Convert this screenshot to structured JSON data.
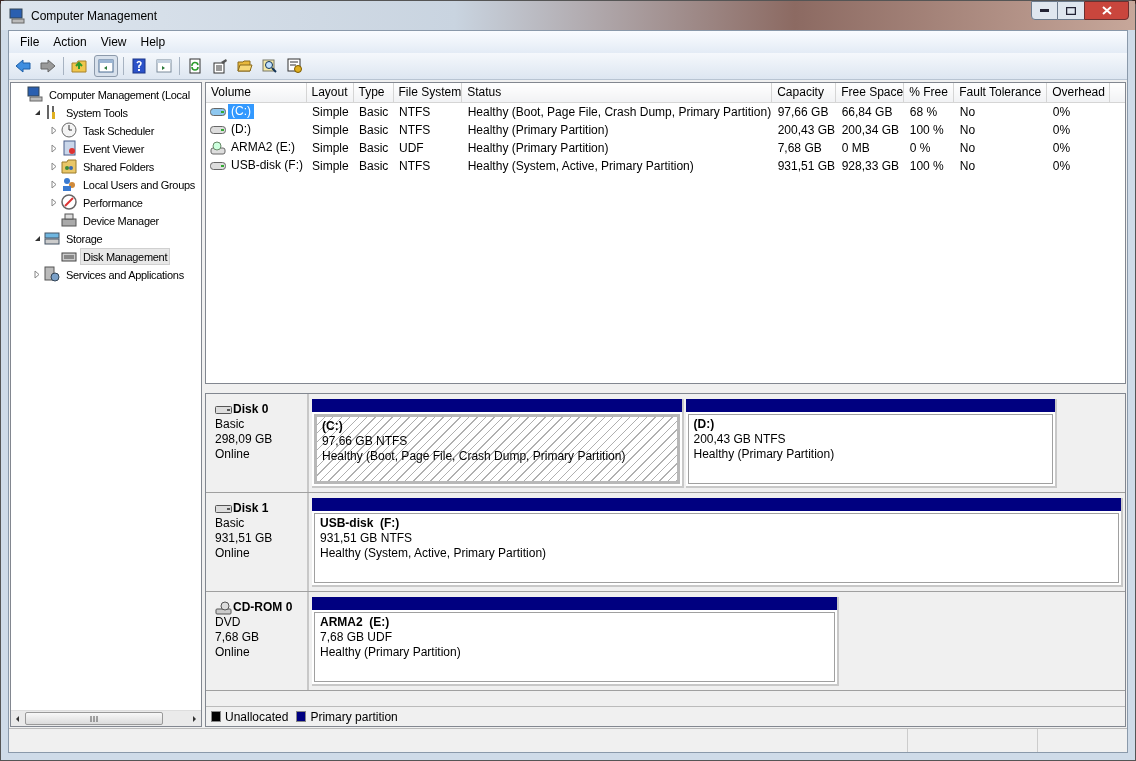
{
  "window": {
    "title": "Computer Management"
  },
  "menu": [
    "File",
    "Action",
    "View",
    "Help"
  ],
  "tree": [
    {
      "label": "Computer Management (Local",
      "selected": false,
      "children": [
        {
          "label": "System Tools",
          "expanded": true,
          "selected": false,
          "children": [
            {
              "label": "Task Scheduler",
              "expanded": false,
              "selected": false
            },
            {
              "label": "Event Viewer",
              "expanded": false,
              "selected": false
            },
            {
              "label": "Shared Folders",
              "expanded": false,
              "selected": false
            },
            {
              "label": "Local Users and Groups",
              "expanded": false,
              "selected": false
            },
            {
              "label": "Performance",
              "expanded": false,
              "selected": false
            },
            {
              "label": "Device Manager",
              "selected": false
            }
          ]
        },
        {
          "label": "Storage",
          "expanded": true,
          "selected": false,
          "children": [
            {
              "label": "Disk Management",
              "selected": true
            }
          ]
        },
        {
          "label": "Services and Applications",
          "expanded": false,
          "selected": false
        }
      ]
    }
  ],
  "table": {
    "columns": [
      "Volume",
      "Layout",
      "Type",
      "File System",
      "Status",
      "Capacity",
      "Free Space",
      "% Free",
      "Fault Tolerance",
      "Overhead"
    ],
    "rows": [
      {
        "kind": "disk",
        "selected": true,
        "cells": [
          "(C:)",
          "Simple",
          "Basic",
          "NTFS",
          "Healthy (Boot, Page File, Crash Dump, Primary Partition)",
          "97,66 GB",
          "66,84 GB",
          "68 %",
          "No",
          "0%"
        ]
      },
      {
        "kind": "disk",
        "selected": false,
        "cells": [
          "(D:)",
          "Simple",
          "Basic",
          "NTFS",
          "Healthy (Primary Partition)",
          "200,43 GB",
          "200,34 GB",
          "100 %",
          "No",
          "0%"
        ]
      },
      {
        "kind": "cdrom",
        "selected": false,
        "cells": [
          "ARMA2 (E:)",
          "Simple",
          "Basic",
          "UDF",
          "Healthy (Primary Partition)",
          "7,68 GB",
          "0 MB",
          "0 %",
          "No",
          "0%"
        ]
      },
      {
        "kind": "disk",
        "selected": false,
        "cells": [
          "USB-disk (F:)",
          "Simple",
          "Basic",
          "NTFS",
          "Healthy (System, Active, Primary Partition)",
          "931,51 GB",
          "928,33 GB",
          "100 %",
          "No",
          "0%"
        ]
      }
    ]
  },
  "disks": [
    {
      "kind": "disk",
      "name": "Disk 0",
      "type": "Basic",
      "size": "298,09 GB",
      "status": "Online",
      "partitions": [
        {
          "name": "(C:)",
          "size": "97,66 GB NTFS",
          "status": "Healthy (Boot, Page File, Crash Dump, Primary Partition)",
          "selected": true
        },
        {
          "name": "(D:)",
          "size": "200,43 GB NTFS",
          "status": "Healthy (Primary Partition)",
          "selected": false
        }
      ]
    },
    {
      "kind": "disk",
      "name": "Disk 1",
      "type": "Basic",
      "size": "931,51 GB",
      "status": "Online",
      "partitions": [
        {
          "name": "USB-disk  (F:)",
          "size": "931,51 GB NTFS",
          "status": "Healthy (System, Active, Primary Partition)",
          "selected": false
        }
      ]
    },
    {
      "kind": "cdrom",
      "name": "CD-ROM 0",
      "type": "DVD",
      "size": "7,68 GB",
      "status": "Online",
      "partitions": [
        {
          "name": "ARMA2  (E:)",
          "size": "7,68 GB UDF",
          "status": "Healthy (Primary Partition)",
          "selected": false
        }
      ]
    }
  ],
  "legend": [
    {
      "label": "Unallocated",
      "color": "#000000"
    },
    {
      "label": "Primary partition",
      "color": "#000080"
    }
  ]
}
